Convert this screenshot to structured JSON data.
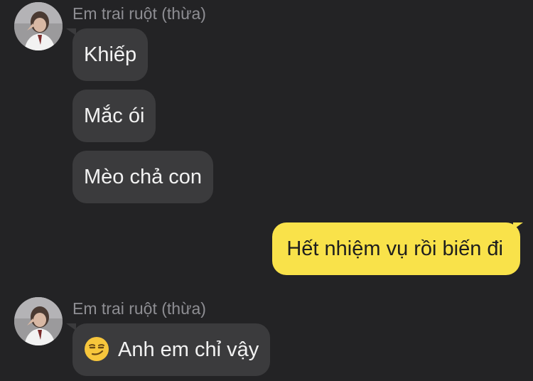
{
  "background_color": "#232325",
  "incoming_bubble_color": "#3b3b3d",
  "outgoing_bubble_color": "#f9e24a",
  "groups": [
    {
      "sender": "Em trai ruột (thừa)",
      "avatar": "user-avatar-photo",
      "messages": [
        "Khiếp",
        "Mắc ói",
        "Mèo chả con"
      ]
    },
    {
      "sender": "Em trai ruột (thừa)",
      "avatar": "user-avatar-photo",
      "messages": [
        {
          "emoji": "smirking-face-emoji",
          "text": "Anh em chỉ vậy"
        }
      ]
    }
  ],
  "outgoing": [
    {
      "text": "Hết nhiệm vụ rồi biến đi"
    }
  ]
}
